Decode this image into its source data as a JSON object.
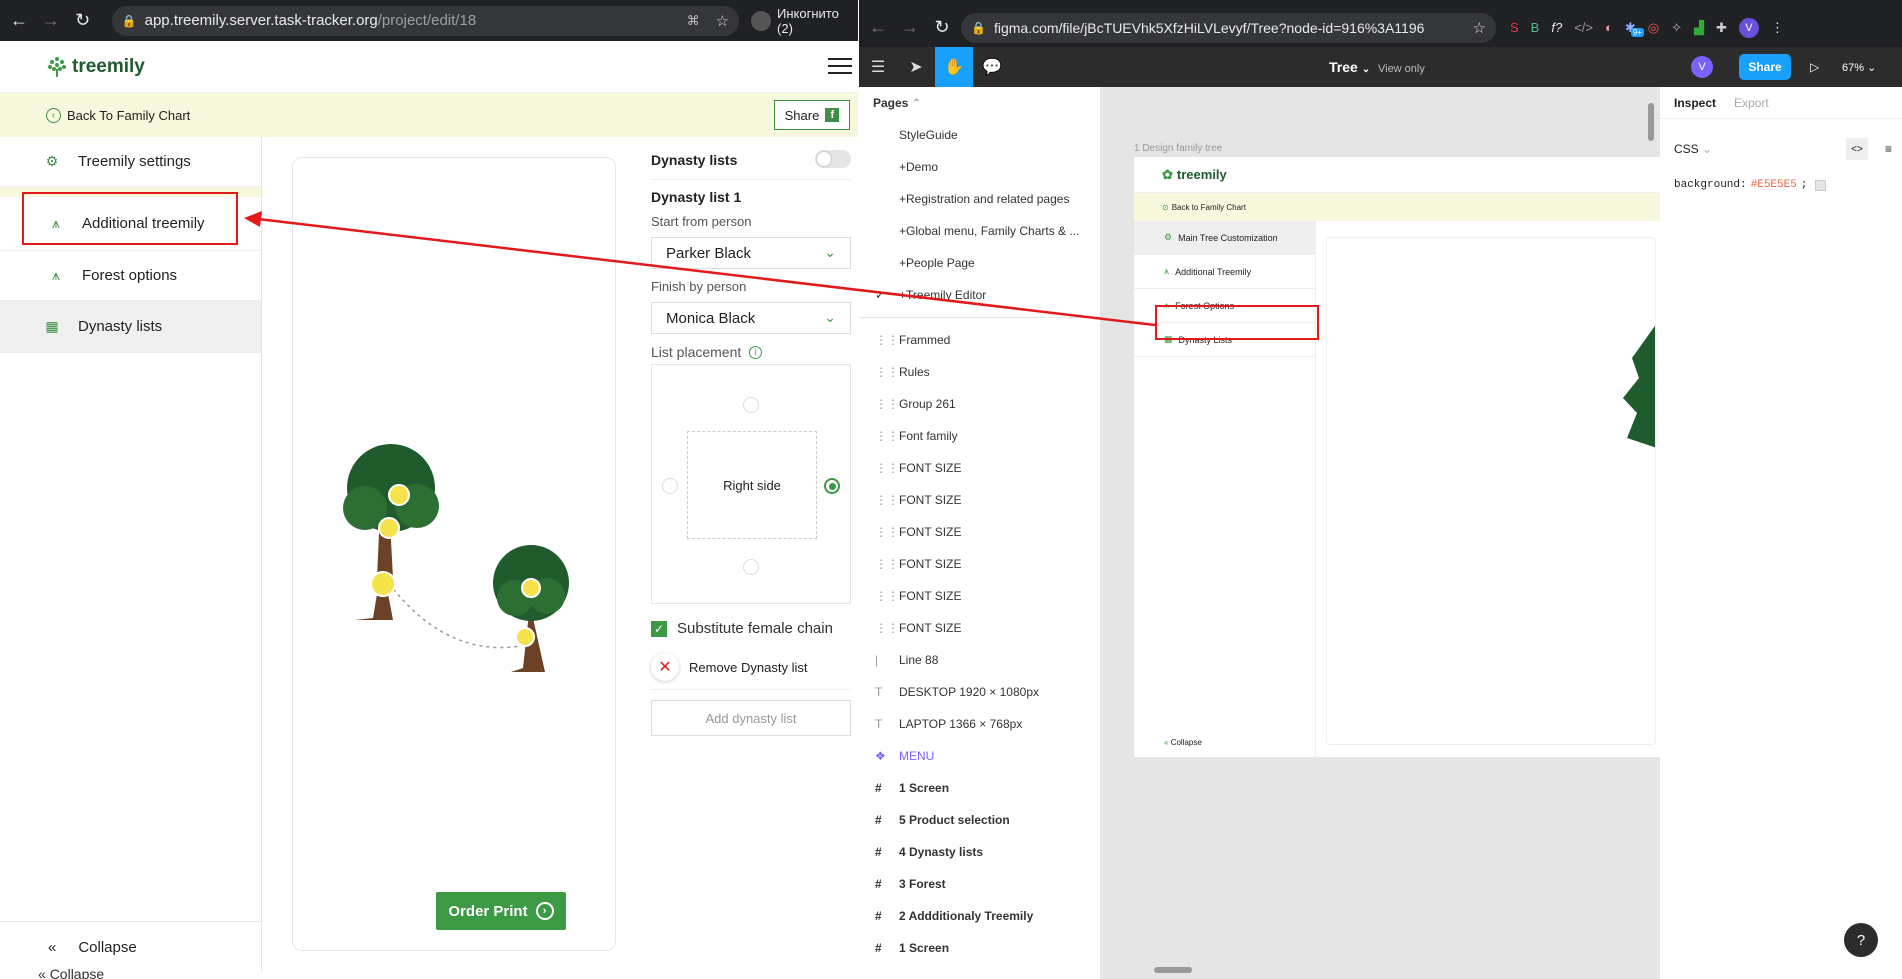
{
  "left_browser": {
    "url_host": "app.treemily.server.task-tracker.org",
    "url_path": "/project/edit/18",
    "incognito": "Инкогнито (2)",
    "brand": "treemily",
    "back_link": "Back To Family Chart",
    "share": "Share",
    "share_icon": "f",
    "sidebar": {
      "items": [
        {
          "label": "Treemily settings",
          "icon": "gear-icon"
        },
        {
          "label": "Additional treemily",
          "icon": "trees-icon"
        },
        {
          "label": "Forest options",
          "icon": "trees-icon"
        },
        {
          "label": "Dynasty lists",
          "icon": "grid-icon"
        }
      ],
      "collapse": "Collapse",
      "collapse_icon": "«",
      "cut_collapse": "Collapse"
    },
    "order_print": "Order Print",
    "panel": {
      "dynasty_lists": "Dynasty lists",
      "list_title": "Dynasty list 1",
      "start_label": "Start from person",
      "start_value": "Parker Black",
      "finish_label": "Finish by person",
      "finish_value": "Monica Black",
      "placement_label": "List placement",
      "placement_value": "Right side",
      "substitute": "Substitute female chain",
      "remove": "Remove Dynasty list",
      "add": "Add dynasty list"
    }
  },
  "right_browser": {
    "url": "figma.com/file/jBcTUEVhk5XfzHiLVLevyf/Tree?node-id=916%3A1196",
    "file_name": "Tree",
    "view_mode": "View only",
    "share": "Share",
    "zoom": "67%",
    "avatar": "V",
    "badge": "9+",
    "pages_header": "Pages",
    "pages": [
      "StyleGuide",
      "+Demo",
      "+Registration and related pages",
      "+Global menu, Family Charts & ...",
      "+People Page",
      "+Treemily Editor"
    ],
    "layers": [
      {
        "icon": "frame-icon",
        "label": "Frammed"
      },
      {
        "icon": "frame-icon",
        "label": "Rules"
      },
      {
        "icon": "frame-icon",
        "label": "Group 261"
      },
      {
        "icon": "frame-icon",
        "label": "Font family"
      },
      {
        "icon": "frame-icon",
        "label": "FONT SIZE"
      },
      {
        "icon": "frame-icon",
        "label": "FONT SIZE"
      },
      {
        "icon": "frame-icon",
        "label": "FONT SIZE"
      },
      {
        "icon": "frame-icon",
        "label": "FONT SIZE"
      },
      {
        "icon": "frame-icon",
        "label": "FONT SIZE"
      },
      {
        "icon": "frame-icon",
        "label": "FONT SIZE"
      },
      {
        "icon": "line-icon",
        "label": "Line 88"
      },
      {
        "icon": "text-icon",
        "label": "DESKTOP 1920 × 1080px"
      },
      {
        "icon": "text-icon",
        "label": "LAPTOP 1366 × 768px"
      },
      {
        "icon": "component-icon",
        "label": "MENU"
      },
      {
        "icon": "hash-icon",
        "label": "1 Screen"
      },
      {
        "icon": "hash-icon",
        "label": "5 Product selection"
      },
      {
        "icon": "hash-icon",
        "label": "4 Dynasty lists"
      },
      {
        "icon": "hash-icon",
        "label": "3 Forest"
      },
      {
        "icon": "hash-icon",
        "label": "2 Addditionaly Treemily"
      },
      {
        "icon": "hash-icon",
        "label": "1 Screen"
      }
    ],
    "canvas": {
      "frame_label": "1 Design family tree",
      "brand": "treemily",
      "back": "Back to Family Chart",
      "menu": [
        "Main Tree Customization",
        "Additional Treemily",
        "Forest Options",
        "Dynasty Lists"
      ],
      "collapse": "Collapse"
    },
    "inspect_tab": "Inspect",
    "export_tab": "Export",
    "css_label": "CSS",
    "css_prop": "background:",
    "css_value": "#E5E5E5",
    "css_semicolon": ";",
    "help": "?"
  },
  "colors": {
    "brand_green": "#3c9a44",
    "annotation_red": "#e21a1a",
    "back_bar": "#f8f8df",
    "figma_blue": "#18a0fb"
  }
}
